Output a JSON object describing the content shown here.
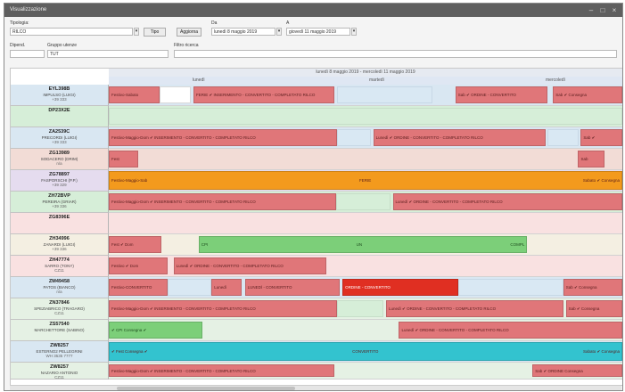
{
  "window": {
    "title": "Visualizzazione"
  },
  "toolbar": {
    "tipologia_label": "Tipologia:",
    "tipologia_value": "RILCO",
    "tipo_btn": "Tipo",
    "aggiorna_btn": "Aggiorna",
    "da_label": "Da",
    "a_label": "A",
    "from_date": "lunedì   8 maggio  2019",
    "to_date": "giovedì  11 maggio  2019",
    "dipendente_label": "Dipend.",
    "gruppo_label": "Gruppo utenze",
    "gruppo_value": "TUT",
    "filtro_label": "Filtro ricerca"
  },
  "grid": {
    "header_range": "lunedì 8 maggio 2019 - mercoledì 11 maggio 2019",
    "day_labels": [
      "lunedì",
      "martedì",
      "mercoledì"
    ]
  },
  "colors": {
    "red": "#e07679",
    "dark_red": "#e02f22",
    "orange": "#f39a1d",
    "cyan": "#33c3cf",
    "green": "#7ccf79",
    "light_blue": "#d9e8f3",
    "light_green": "#d6eed8",
    "pink_bg": "#f9e1e1",
    "cream_bg": "#f4efe2",
    "mint_bg": "#e5f1e4"
  },
  "rows": [
    {
      "code": "EYL398B",
      "name": "IMPULSO (LUIGI)",
      "sub": "+39 333",
      "bg": "#d9e7f2",
      "segs": [
        {
          "c": "red",
          "l": 0,
          "w": 9.9,
          "t": "Festivo-Sabato"
        },
        {
          "c": "white",
          "l": 9.9,
          "w": 6.1,
          "t": ""
        },
        {
          "c": "red",
          "l": 16.5,
          "w": 27.5,
          "t": "FERIE ✔ INSERIMENTO - CONVERTITO - COMPLETATO RILCO"
        },
        {
          "c": "lblue",
          "l": 44.5,
          "w": 18.5,
          "t": ""
        },
        {
          "c": "red",
          "l": 67.5,
          "w": 18,
          "t": "Sab ✔ ORDINE - CONVERTITO"
        },
        {
          "c": "red",
          "l": 86.5,
          "w": 13.5,
          "t": "Sab ✔ Consegna"
        }
      ]
    },
    {
      "code": "DP23X2E",
      "name": "",
      "sub": "",
      "bg": "#d6eed8",
      "segs": [
        {
          "c": "lgreen",
          "l": 0,
          "w": 100,
          "t": ""
        }
      ]
    },
    {
      "code": "ZA2539C",
      "name": "PRECORDI (LUIGI)",
      "sub": "+39 333",
      "bg": "#d9e7f2",
      "segs": [
        {
          "c": "red",
          "l": 0,
          "w": 44.4,
          "t": "Festivo-Maggio-Dom ✔ INSERIMENTO - CONVERTITO - COMPLETATO RILCO"
        },
        {
          "c": "lblue",
          "l": 44.4,
          "w": 6.6,
          "t": ""
        },
        {
          "c": "red",
          "l": 51.5,
          "w": 33.5,
          "t": "Lunedì ✔ ORDINE - CONVERTITO - COMPLETATO RILCO"
        },
        {
          "c": "lblue",
          "l": 85.5,
          "w": 6,
          "t": ""
        },
        {
          "c": "red",
          "l": 91.9,
          "w": 8.1,
          "t": "Sab ✔"
        }
      ]
    },
    {
      "code": "ZG13989",
      "name": "SODACERO (DRIM)",
      "sub": "n/a",
      "bg": "#f2dcd6",
      "segs": [
        {
          "c": "red",
          "l": 0,
          "w": 5.7,
          "t": "Fest"
        },
        {
          "c": "red",
          "l": 91.4,
          "w": 5.1,
          "t": "Sab"
        }
      ]
    },
    {
      "code": "ZG78897",
      "name": "FASPORSCHI (P.P.)",
      "sub": "+39 329",
      "bg": "#e5dcef",
      "segs": [
        {
          "c": "orange",
          "l": 0,
          "w": 100,
          "t": "Festivo-Maggio-Sab",
          "m": "FERIE",
          "r": "Sabato ✔ Consegna"
        }
      ]
    },
    {
      "code": "ZH72BVP",
      "name": "PEREIRA (GRIAR)",
      "sub": "+39 336",
      "bg": "#d6eed8",
      "segs": [
        {
          "c": "red",
          "l": 0,
          "w": 44.3,
          "t": "Festivo-Maggio-Dom ✔ INSERIMENTO - CONVERTITO - COMPLETATO RILCO"
        },
        {
          "c": "lgreen",
          "l": 44.3,
          "w": 10.5,
          "t": ""
        },
        {
          "c": "red",
          "l": 55.3,
          "w": 44.7,
          "t": "Lunedì ✔ ORDINE - CONVERTITO - COMPLETATO RILCO"
        }
      ]
    },
    {
      "code": "ZG8396E",
      "name": "",
      "sub": "",
      "bg": "#f9e1e1",
      "segs": []
    },
    {
      "code": "ZH34996",
      "name": "ZANARDI (LUIGI)",
      "sub": "+39 336",
      "bg": "#f4efe2",
      "segs": [
        {
          "c": "red",
          "l": 0,
          "w": 10.2,
          "t": "Fest ✔ Dom"
        },
        {
          "c": "green",
          "l": 17.5,
          "w": 64,
          "t": "CPI",
          "m": "UN",
          "r": "COMPL"
        }
      ]
    },
    {
      "code": "ZH47774",
      "name": "SARRO (TONY)",
      "sub": "CZ11",
      "bg": "#f9e1e1",
      "segs": [
        {
          "c": "red",
          "l": 0,
          "w": 11.5,
          "t": "Festivo ✔ Dom"
        },
        {
          "c": "red",
          "l": 12.6,
          "w": 29.8,
          "t": "Lunedì ✔ ORDINE - CONVERTITO - COMPLETATO RILCO"
        }
      ]
    },
    {
      "code": "ZM49458",
      "name": "PATOS (BIANCO)",
      "sub": "n/a",
      "bg": "#d9e7f2",
      "segs": [
        {
          "c": "red",
          "l": 0,
          "w": 11.5,
          "t": "Festivo-CONVERTITO"
        },
        {
          "c": "lblue",
          "l": 11.5,
          "w": 8.5,
          "t": ""
        },
        {
          "c": "red",
          "l": 20,
          "w": 5.8,
          "t": "Lunedì"
        },
        {
          "c": "red",
          "l": 26.5,
          "w": 18.5,
          "t": "LUNEDÌ - CONVERTITO"
        },
        {
          "c": "dred",
          "l": 45.5,
          "w": 22.5,
          "t": "ORDINE - CONVERTITO"
        },
        {
          "c": "lblue",
          "l": 68,
          "w": 20.5,
          "t": ""
        },
        {
          "c": "red",
          "l": 88.5,
          "w": 11.5,
          "t": "Sab ✔ Consegna"
        }
      ]
    },
    {
      "code": "ZN37846",
      "name": "SPEZIABRICO (TRAGARO)",
      "sub": "CZ11",
      "bg": "#e5f1e4",
      "segs": [
        {
          "c": "red",
          "l": 0,
          "w": 44.5,
          "t": "Festivo-Maggio-Dom ✔ INSERIMENTO - CONVERTITO - COMPLETATO RILCO"
        },
        {
          "c": "lgreen",
          "l": 44.5,
          "w": 9,
          "t": ""
        },
        {
          "c": "red",
          "l": 54,
          "w": 34.5,
          "t": "Lunedì ✔ ORDINE - CONVERTITO - COMPLETATO RILCO"
        },
        {
          "c": "red",
          "l": 89,
          "w": 11,
          "t": "Sab ✔ Consegna"
        }
      ]
    },
    {
      "code": "ZS57540",
      "name": "MARCHETTORE (SABINO)",
      "sub": "",
      "bg": "#e5f1e4",
      "segs": [
        {
          "c": "green",
          "l": 0,
          "w": 18.3,
          "t": "✔ CPI Consegna ✔"
        },
        {
          "c": "red",
          "l": 56.5,
          "w": 43.5,
          "t": "Lunedì ✔ ORDINE - CONVERTITO - COMPLETATO RILCO"
        }
      ]
    },
    {
      "code": "ZW8257",
      "name": "ESTERNO2 PELLEGRINI",
      "sub": "WH 3535 7777",
      "bg": "#d9e7f2",
      "segs": [
        {
          "c": "cyan",
          "l": 0,
          "w": 100,
          "t": "✔ Fest Consegna ✔",
          "m": "CONVERTITO",
          "r": "Sabato ✔ Consegna"
        }
      ]
    },
    {
      "code": "ZW8257",
      "name": "NAZARIO ANTONIO",
      "sub": "CZ11",
      "bg": "#e5f1e4",
      "segs": [
        {
          "c": "red",
          "l": 0,
          "w": 44,
          "t": "Festivo-Maggio-Dom ✔ INSERIMENTO - CONVERTITO - COMPLETATO RILCO"
        },
        {
          "c": "red",
          "l": 82.5,
          "w": 17.5,
          "t": "Sab ✔ ORDINE Consegna"
        }
      ]
    }
  ],
  "footer": {
    "scrollbar": "horizontal"
  }
}
